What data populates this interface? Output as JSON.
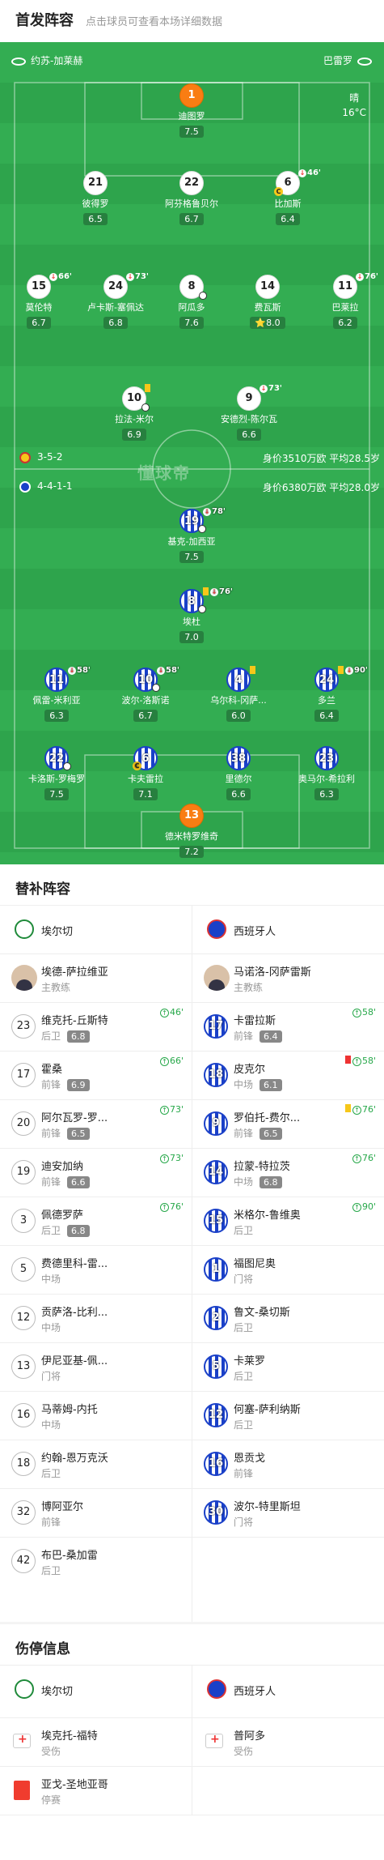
{
  "header": {
    "title": "首发阵容",
    "subtitle": "点击球员可查看本场详细数据"
  },
  "pitch": {
    "home_team": "约苏-加莱赫",
    "away_team": "巴雷罗",
    "weather": "晴",
    "temperature": "16°C",
    "watermark": "懂球帝",
    "home_formation": "3-5-2",
    "away_formation": "4-4-1-1",
    "home_value": "身价3510万欧 平均28.5岁",
    "away_value": "身价6380万欧 平均28.0岁",
    "home_players": [
      {
        "number": "1",
        "name": "迪图罗",
        "rating": "7.5"
      },
      {
        "number": "21",
        "name": "彼得罗",
        "rating": "6.5"
      },
      {
        "number": "22",
        "name": "阿芬格鲁贝尔",
        "rating": "6.7"
      },
      {
        "number": "6",
        "name": "比加斯",
        "rating": "6.4",
        "event": "46'"
      },
      {
        "number": "15",
        "name": "莫伦特",
        "rating": "6.7",
        "event": "66'"
      },
      {
        "number": "24",
        "name": "卢卡斯-塞佩达",
        "rating": "6.8",
        "event": "73'"
      },
      {
        "number": "8",
        "name": "阿瓜多",
        "rating": "7.6"
      },
      {
        "number": "14",
        "name": "费瓦斯",
        "rating": "8.0"
      },
      {
        "number": "11",
        "name": "巴莱拉",
        "rating": "6.2",
        "event": "76'"
      },
      {
        "number": "10",
        "name": "拉法-米尔",
        "rating": "6.9"
      },
      {
        "number": "9",
        "name": "安德烈-陈尔瓦",
        "rating": "6.6",
        "event": "73'"
      }
    ],
    "away_players": [
      {
        "number": "19",
        "name": "基克-加西亚",
        "rating": "7.5",
        "event": "78'"
      },
      {
        "number": "8",
        "name": "埃杜",
        "rating": "7.0",
        "event": "76'"
      },
      {
        "number": "11",
        "name": "佩雷-米利亚",
        "rating": "6.3",
        "event": "58'"
      },
      {
        "number": "10",
        "name": "波尔-洛斯诺",
        "rating": "6.7",
        "event": "58'"
      },
      {
        "number": "4",
        "name": "乌尔科-冈萨...",
        "rating": "6.0"
      },
      {
        "number": "24",
        "name": "多兰",
        "rating": "6.4",
        "event": "90'"
      },
      {
        "number": "22",
        "name": "卡洛斯-罗梅罗",
        "rating": "7.5"
      },
      {
        "number": "6",
        "name": "卡夫雷拉",
        "rating": "7.1"
      },
      {
        "number": "38",
        "name": "里德尔",
        "rating": "6.6"
      },
      {
        "number": "23",
        "name": "奥马尔-希拉利",
        "rating": "6.3"
      },
      {
        "number": "13",
        "name": "德米特罗维奇",
        "rating": "7.2"
      }
    ]
  },
  "subs": {
    "title": "替补阵容",
    "home_team": "埃尔切",
    "away_team": "西班牙人",
    "home_coach": {
      "name": "埃德-萨拉维亚",
      "role": "主教练"
    },
    "away_coach": {
      "name": "马诺洛-冈萨雷斯",
      "role": "主教练"
    },
    "home": [
      {
        "number": "23",
        "name": "维克托-丘斯特",
        "pos": "后卫",
        "rating": "6.8",
        "event": "46'"
      },
      {
        "number": "17",
        "name": "霍桑",
        "pos": "前锋",
        "rating": "6.9",
        "event": "66'"
      },
      {
        "number": "20",
        "name": "阿尔瓦罗-罗...",
        "pos": "前锋",
        "rating": "6.5",
        "event": "73'"
      },
      {
        "number": "19",
        "name": "迪安加纳",
        "pos": "前锋",
        "rating": "6.6",
        "event": "73'"
      },
      {
        "number": "3",
        "name": "佩德罗萨",
        "pos": "后卫",
        "rating": "6.8",
        "event": "76'"
      },
      {
        "number": "5",
        "name": "费德里科-雷...",
        "pos": "中场"
      },
      {
        "number": "12",
        "name": "贡萨洛-比利...",
        "pos": "中场"
      },
      {
        "number": "13",
        "name": "伊尼亚基-佩...",
        "pos": "门将"
      },
      {
        "number": "16",
        "name": "马蒂姆-内托",
        "pos": "中场"
      },
      {
        "number": "18",
        "name": "约翰-恩万克沃",
        "pos": "后卫"
      },
      {
        "number": "32",
        "name": "博阿亚尔",
        "pos": "前锋"
      },
      {
        "number": "42",
        "name": "布巴-桑加雷",
        "pos": "后卫"
      }
    ],
    "away": [
      {
        "number": "17",
        "name": "卡雷拉斯",
        "pos": "前锋",
        "rating": "6.4",
        "event": "58'"
      },
      {
        "number": "18",
        "name": "皮克尔",
        "pos": "中场",
        "rating": "6.1",
        "event": "58'"
      },
      {
        "number": "9",
        "name": "罗伯托-费尔...",
        "pos": "前锋",
        "rating": "6.5",
        "event": "76'"
      },
      {
        "number": "14",
        "name": "拉蒙-特拉茨",
        "pos": "中场",
        "rating": "6.8",
        "event": "76'"
      },
      {
        "number": "15",
        "name": "米格尔-鲁维奥",
        "pos": "后卫",
        "event": "90'"
      },
      {
        "number": "1",
        "name": "福图尼奥",
        "pos": "门将"
      },
      {
        "number": "2",
        "name": "鲁文-桑切斯",
        "pos": "后卫"
      },
      {
        "number": "5",
        "name": "卡莱罗",
        "pos": "后卫"
      },
      {
        "number": "12",
        "name": "何塞-萨利纳斯",
        "pos": "后卫"
      },
      {
        "number": "16",
        "name": "恩贡戈",
        "pos": "前锋"
      },
      {
        "number": "30",
        "name": "波尔-特里斯坦",
        "pos": "门将"
      }
    ]
  },
  "injury": {
    "title": "伤停信息",
    "home_team": "埃尔切",
    "away_team": "西班牙人",
    "home": [
      {
        "name": "埃克托-福特",
        "status": "受伤"
      },
      {
        "name": "亚戈-圣地亚哥",
        "status": "停赛"
      }
    ],
    "away": [
      {
        "name": "普阿多",
        "status": "受伤"
      }
    ]
  },
  "colors": {
    "pitch": "#2ea44c",
    "rating_bg": "#27803f",
    "home_gk": "#f97d13",
    "away_stripe": "#1a40c8",
    "sub_green": "#27a84a",
    "red_card": "#f03c2e",
    "yellow_card": "#f6c71a"
  }
}
